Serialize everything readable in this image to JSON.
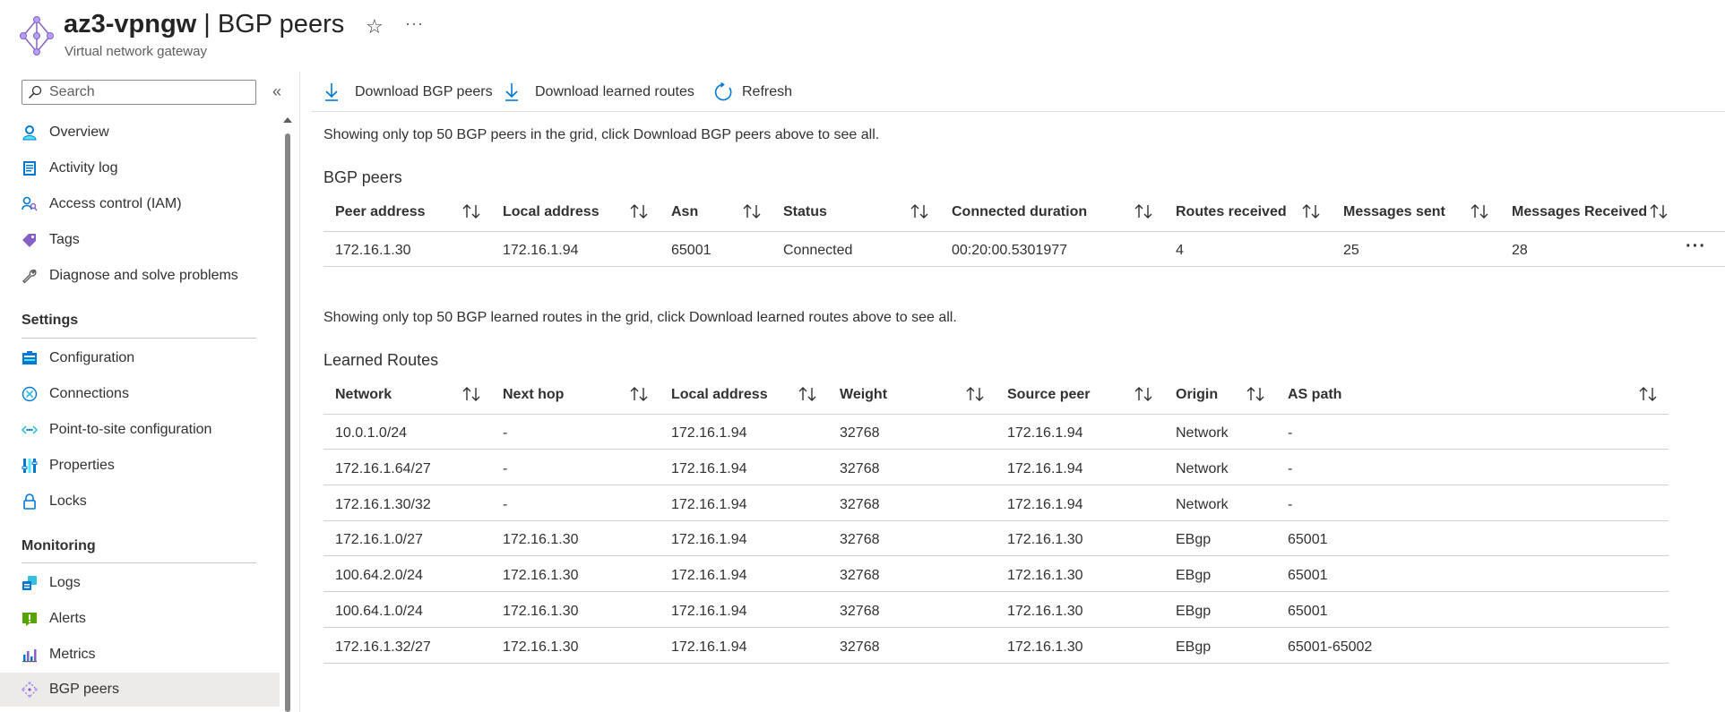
{
  "header": {
    "resource_name": "az3-vpngw",
    "separator": " | ",
    "page_title": "BGP peers",
    "subtitle": "Virtual network gateway"
  },
  "sidebar": {
    "search_placeholder": "Search",
    "items_top": [
      {
        "label": "Overview",
        "icon": "overview-icon"
      },
      {
        "label": "Activity log",
        "icon": "activity-log-icon"
      },
      {
        "label": "Access control (IAM)",
        "icon": "iam-icon"
      },
      {
        "label": "Tags",
        "icon": "tag-icon"
      },
      {
        "label": "Diagnose and solve problems",
        "icon": "wrench-icon"
      }
    ],
    "settings_heading": "Settings",
    "items_settings": [
      {
        "label": "Configuration",
        "icon": "configuration-icon"
      },
      {
        "label": "Connections",
        "icon": "connections-icon"
      },
      {
        "label": "Point-to-site configuration",
        "icon": "p2s-icon"
      },
      {
        "label": "Properties",
        "icon": "properties-icon"
      },
      {
        "label": "Locks",
        "icon": "lock-icon"
      }
    ],
    "monitoring_heading": "Monitoring",
    "items_monitoring": [
      {
        "label": "Logs",
        "icon": "logs-icon"
      },
      {
        "label": "Alerts",
        "icon": "alerts-icon"
      },
      {
        "label": "Metrics",
        "icon": "metrics-icon"
      },
      {
        "label": "BGP peers",
        "icon": "bgp-peers-icon",
        "active": true
      }
    ]
  },
  "toolbar": {
    "download_peers": "Download BGP peers",
    "download_routes": "Download learned routes",
    "refresh": "Refresh"
  },
  "peers": {
    "info": "Showing only top 50 BGP peers in the grid, click Download BGP peers above to see all.",
    "title": "BGP peers",
    "columns": [
      "Peer address",
      "Local address",
      "Asn",
      "Status",
      "Connected duration",
      "Routes received",
      "Messages sent",
      "Messages Received"
    ],
    "rows": [
      [
        "172.16.1.30",
        "172.16.1.94",
        "65001",
        "Connected",
        "00:20:00.5301977",
        "4",
        "25",
        "28"
      ]
    ]
  },
  "routes": {
    "info": "Showing only top 50 BGP learned routes in the grid, click Download learned routes above to see all.",
    "title": "Learned Routes",
    "columns": [
      "Network",
      "Next hop",
      "Local address",
      "Weight",
      "Source peer",
      "Origin",
      "AS path"
    ],
    "rows": [
      [
        "10.0.1.0/24",
        "-",
        "172.16.1.94",
        "32768",
        "172.16.1.94",
        "Network",
        "-"
      ],
      [
        "172.16.1.64/27",
        "-",
        "172.16.1.94",
        "32768",
        "172.16.1.94",
        "Network",
        "-"
      ],
      [
        "172.16.1.30/32",
        "-",
        "172.16.1.94",
        "32768",
        "172.16.1.94",
        "Network",
        "-"
      ],
      [
        "172.16.1.0/27",
        "172.16.1.30",
        "172.16.1.94",
        "32768",
        "172.16.1.30",
        "EBgp",
        "65001"
      ],
      [
        "100.64.2.0/24",
        "172.16.1.30",
        "172.16.1.94",
        "32768",
        "172.16.1.30",
        "EBgp",
        "65001"
      ],
      [
        "100.64.1.0/24",
        "172.16.1.30",
        "172.16.1.94",
        "32768",
        "172.16.1.30",
        "EBgp",
        "65001"
      ],
      [
        "172.16.1.32/27",
        "172.16.1.30",
        "172.16.1.94",
        "32768",
        "172.16.1.30",
        "EBgp",
        "65001-65002"
      ]
    ]
  },
  "colors": {
    "accent": "#0078d4",
    "text": "#323130",
    "active_bg": "#edebe9"
  }
}
